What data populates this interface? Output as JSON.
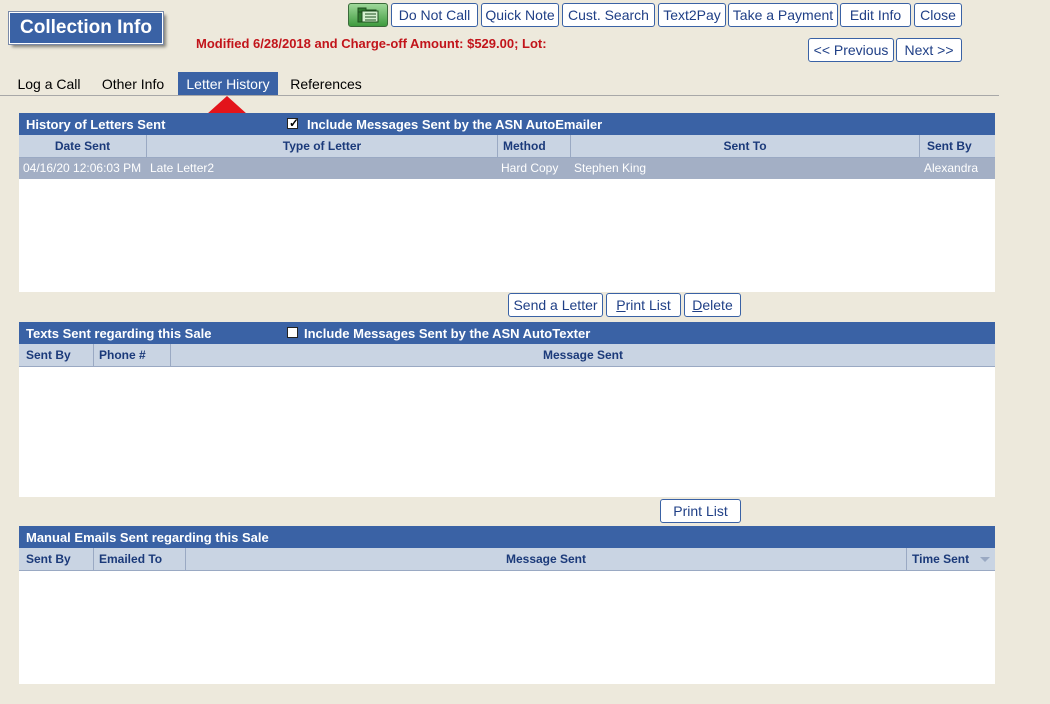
{
  "header": {
    "title": "Collection Info",
    "modified_text": "Modified 6/28/2018 and Charge-off Amount: $529.00; Lot:"
  },
  "toolbar": {
    "folder_icon": "folder-icon",
    "buttons": [
      "Do Not Call",
      "Quick Note",
      "Cust. Search",
      "Text2Pay",
      "Take a Payment",
      "Edit Info",
      "Close"
    ],
    "previous": "<< Previous",
    "next": "Next >>"
  },
  "tabs": [
    "Log a Call",
    "Other Info",
    "Letter History",
    "References"
  ],
  "active_tab": "Letter History",
  "letters": {
    "title": "History of Letters Sent",
    "checkbox_label": "Include Messages Sent by the ASN AutoEmailer",
    "checked": true,
    "columns": [
      "Date Sent",
      "Type of Letter",
      "Method",
      "Sent To",
      "Sent By"
    ],
    "rows": [
      {
        "date_sent": "04/16/20 12:06:03 PM",
        "type": "Late Letter2",
        "method": "Hard Copy",
        "sent_to": "Stephen King",
        "sent_by": "Alexandra"
      }
    ],
    "buttons": {
      "send": "Send a Letter",
      "print_prefix": "P",
      "print_rest": "rint List",
      "delete_prefix": "D",
      "delete_rest": "elete"
    }
  },
  "texts": {
    "title": "Texts Sent regarding this Sale",
    "checkbox_label": "Include Messages Sent by the ASN AutoTexter",
    "checked": false,
    "columns": [
      "Sent By",
      "Phone #",
      "Message Sent"
    ],
    "print_button": "Print List"
  },
  "emails": {
    "title": "Manual Emails Sent regarding this Sale",
    "columns": [
      "Sent By",
      "Emailed To",
      "Message Sent",
      "Time Sent"
    ]
  },
  "colors": {
    "accent": "#3a62a5",
    "modified": "#c2141a",
    "arrow": "#e3141b",
    "background": "#ede9dc"
  }
}
